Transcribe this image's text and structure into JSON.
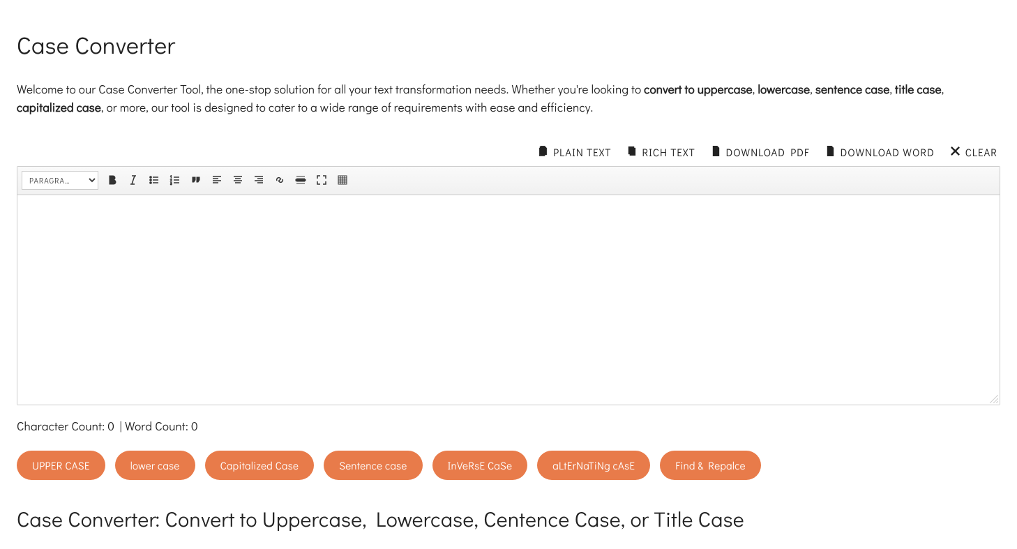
{
  "title": "Case Converter",
  "intro": {
    "pre": "Welcome to our Case Converter Tool, the one-stop solution for all your text transformation needs. Whether you're looking to ",
    "b1": "convert to uppercase",
    "sep1": ", ",
    "b2": "lowercase",
    "sep2": ", ",
    "b3": "sentence case",
    "sep3": ", ",
    "b4": "title case",
    "sep4": ", ",
    "b5": "capitalized case",
    "post": ", or more, our tool is designed to cater to a wide range of requirements with ease and efficiency."
  },
  "top_actions": {
    "plain": "PLAIN TEXT",
    "rich": "RICH TEXT",
    "pdf": "DOWNLOAD PDF",
    "word": "DOWNLOAD WORD",
    "clear": "CLEAR"
  },
  "toolbar": {
    "format_selected": "PARAGRA…"
  },
  "counts": {
    "char_label": "Character Count: ",
    "char_value": "0",
    "sep": " | ",
    "word_label": "Word Count: ",
    "word_value": "0"
  },
  "buttons": {
    "upper": "UPPER CASE",
    "lower": "lower case",
    "capitalized": "Capitalized Case",
    "sentence": "Sentence case",
    "inverse": "InVeRsE CaSe",
    "alternating": "aLtErNaTiNg cAsE",
    "find": "Find & Repalce"
  },
  "sub_heading": "Case Converter: Convert to Uppercase, Lowercase, Centence Case, or Title Case"
}
